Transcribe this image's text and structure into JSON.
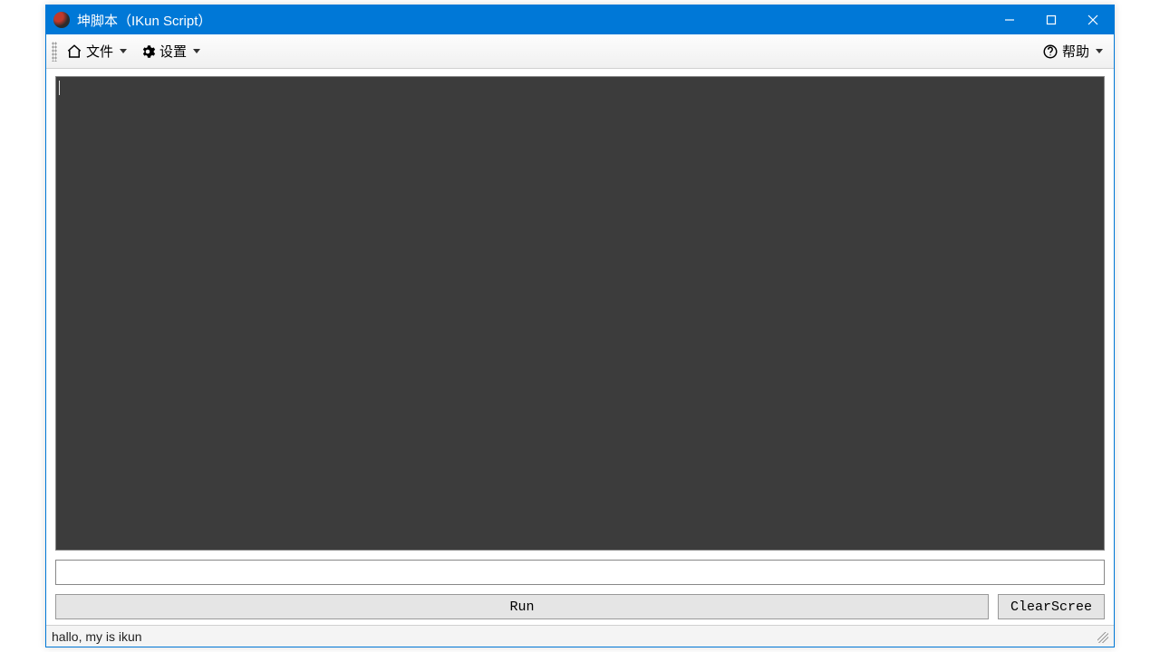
{
  "window": {
    "title": "坤脚本（IKun Script）"
  },
  "toolbar": {
    "file_label": "文件",
    "settings_label": "设置",
    "help_label": "帮助"
  },
  "editor": {
    "content": ""
  },
  "command_input": {
    "value": ""
  },
  "buttons": {
    "run_label": "Run",
    "clear_label": "ClearScree"
  },
  "statusbar": {
    "text": "hallo, my is ikun"
  },
  "colors": {
    "titlebar_bg": "#0078d7",
    "editor_bg": "#3c3c3c",
    "button_bg": "#e5e5e5"
  }
}
